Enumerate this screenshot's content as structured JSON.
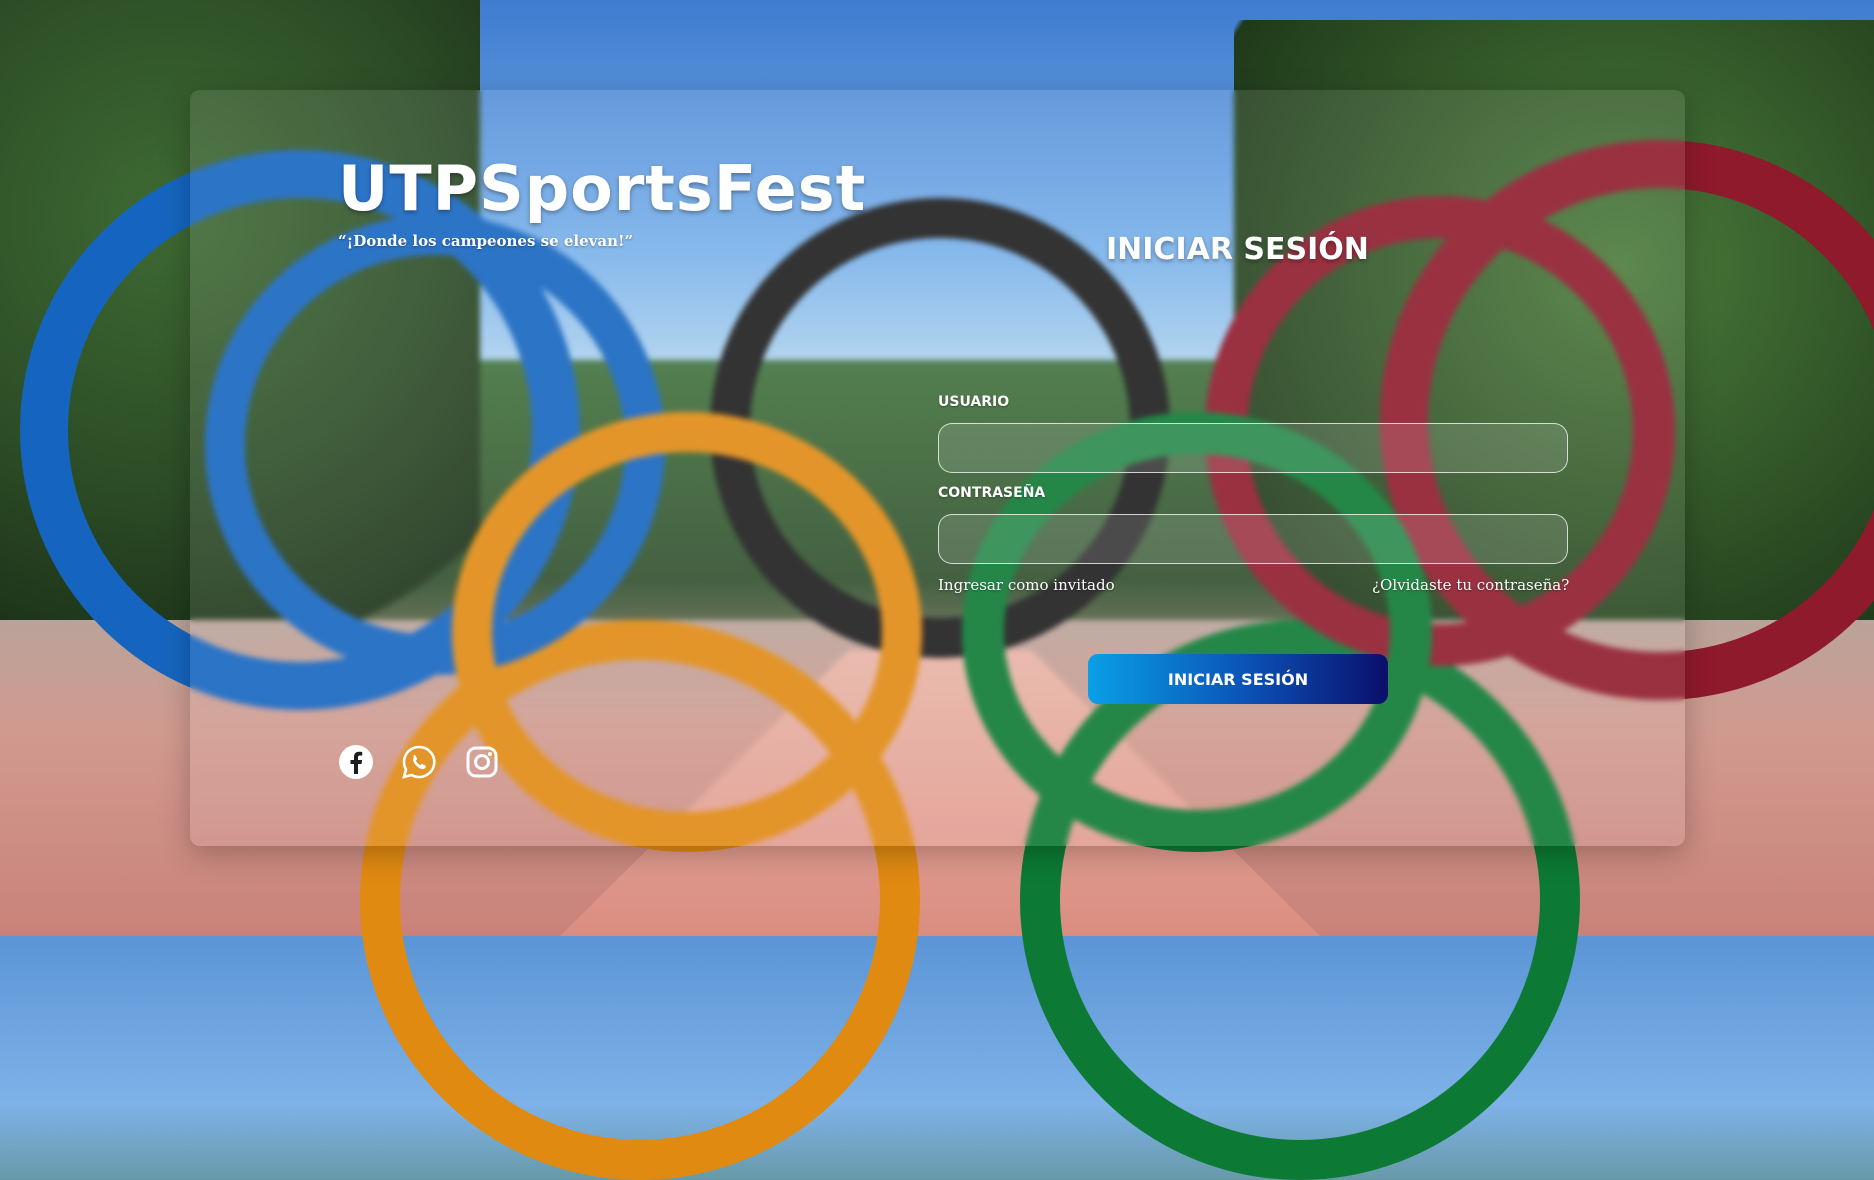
{
  "brand": {
    "title": "UTPSportsFest",
    "tagline": "“¡Donde los campeones se elevan!”"
  },
  "social": [
    {
      "icon": "facebook-icon"
    },
    {
      "icon": "whatsapp-icon"
    },
    {
      "icon": "instagram-icon"
    }
  ],
  "login": {
    "title": "INICIAR SESIÓN",
    "username_label": "USUARIO",
    "username_value": "",
    "password_label": "CONTRASEÑA",
    "password_value": "",
    "guest_link": "Ingresar como invitado",
    "forgot_link": "¿Olvidaste tu contraseña?",
    "submit_label": "INICIAR SESIÓN"
  },
  "colors": {
    "button_gradient_start": "#0a9fe6",
    "button_gradient_end": "#0a0f6b",
    "text": "#ffffff"
  }
}
